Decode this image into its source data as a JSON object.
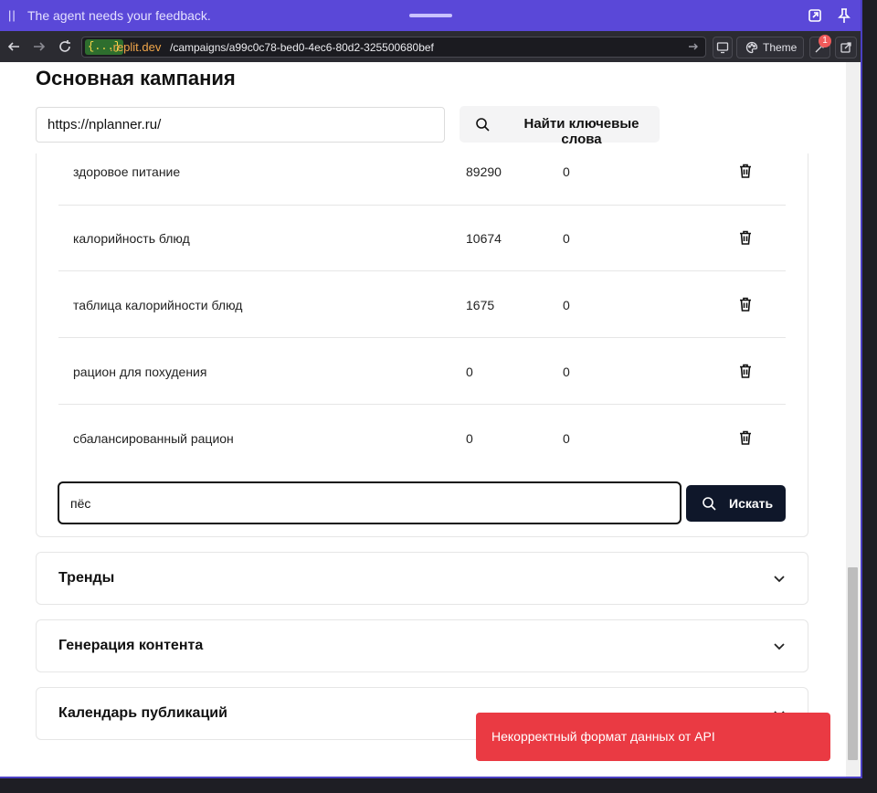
{
  "agent_bar": {
    "message": "The agent needs your feedback.",
    "pause_glyph": "||"
  },
  "browser": {
    "domain_prefix": "{...}",
    "domain_suffix": ".replit.dev",
    "url_path": "/campaigns/a99c0c78-bed0-4ec6-80d2-325500680bef",
    "theme_label": "Theme",
    "notification_count": "1"
  },
  "page": {
    "title": "Основная кампания",
    "url_value": "https://nplanner.ru/",
    "find_button": "Найти ключевые слова",
    "keywords": [
      {
        "keyword": "здоровое питание",
        "value1": "89290",
        "value2": "0"
      },
      {
        "keyword": "калорийность блюд",
        "value1": "10674",
        "value2": "0"
      },
      {
        "keyword": "таблица калорийности блюд",
        "value1": "1675",
        "value2": "0"
      },
      {
        "keyword": "рацион для похудения",
        "value1": "0",
        "value2": "0"
      },
      {
        "keyword": "сбалансированный рацион",
        "value1": "0",
        "value2": "0"
      }
    ],
    "search_value": "пёс",
    "search_button": "Искать",
    "sections": [
      {
        "label": "Тренды"
      },
      {
        "label": "Генерация контента"
      },
      {
        "label": "Календарь публикаций"
      }
    ]
  },
  "toast": {
    "message": "Некорректный формат данных от API",
    "color": "#ea3a43"
  }
}
